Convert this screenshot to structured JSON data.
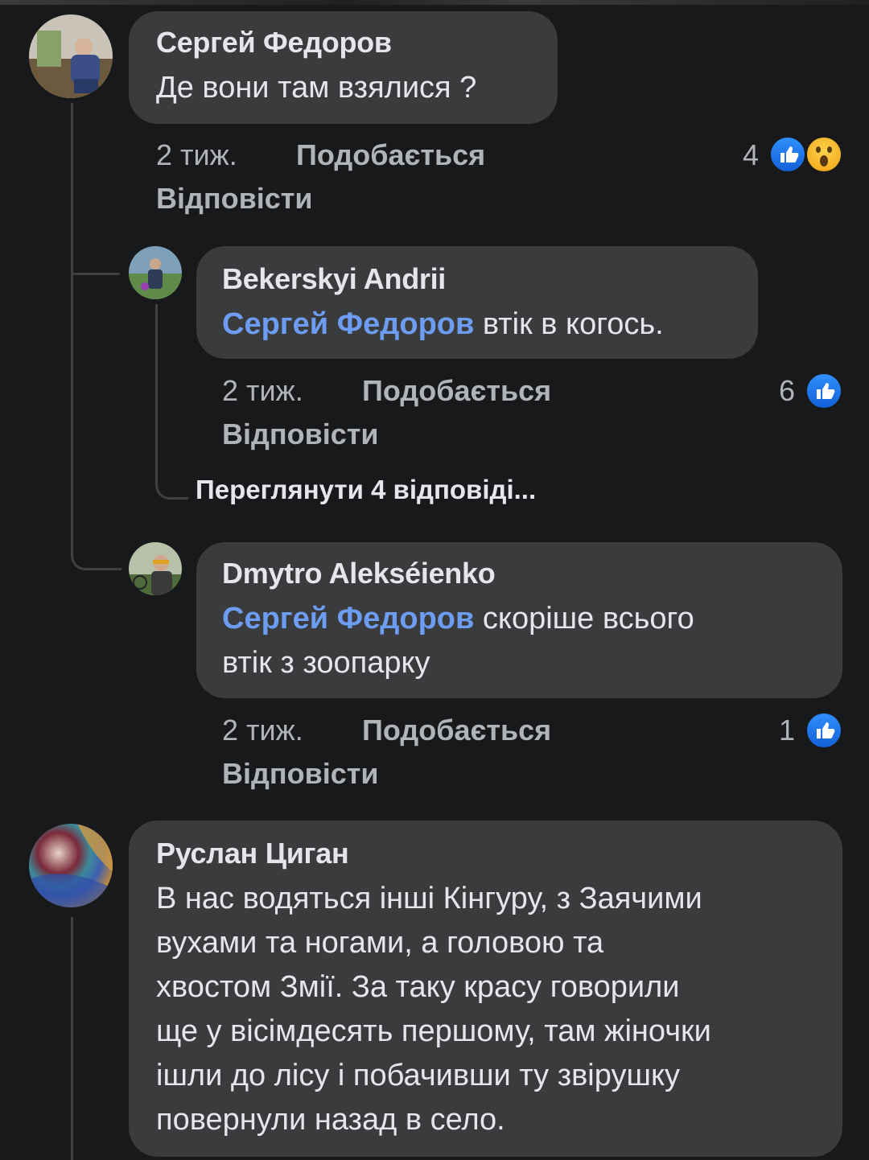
{
  "comments": [
    {
      "author": "Сергей Федоров",
      "text": "Де вони там взялися ?",
      "time": "2 тиж.",
      "like_label": "Подобається",
      "reply_label": "Відповісти",
      "reaction_count": "4",
      "reactions": [
        "like-icon",
        "wow-icon"
      ]
    },
    {
      "author": "Bekerskyi Andrii",
      "mention": "Сергей Федоров",
      "text": " втік в когось.",
      "time": "2 тиж.",
      "like_label": "Подобається",
      "reply_label": "Відповісти",
      "reaction_count": "6",
      "reactions": [
        "like-icon"
      ]
    },
    {
      "view_replies": "Переглянути 4 відповіді..."
    },
    {
      "author": "Dmytro Alekséienko",
      "mention": "Сергей Федоров",
      "text_line1": " скоріше всього",
      "text_line2": "втік з зоопарку",
      "time": "2 тиж.",
      "like_label": "Подобається",
      "reply_label": "Відповісти",
      "reaction_count": "1",
      "reactions": [
        "like-icon"
      ]
    },
    {
      "author": "Руслан Циган",
      "text_lines": [
        "В нас водяться інші Кінгуру, з Заячими",
        "вухами та ногами, а головою та",
        "хвостом Змії. За таку красу говорили",
        "ще у вісімдесять першому, там жіночки",
        "ішли до лісу і побачивши ту звірушку",
        "повернули назад в село."
      ]
    }
  ],
  "colors": {
    "background": "#18191a",
    "bubble": "#3a3b3c",
    "mention": "#6d9df2",
    "meta": "#b0b3b8",
    "like": "#1877f2"
  }
}
